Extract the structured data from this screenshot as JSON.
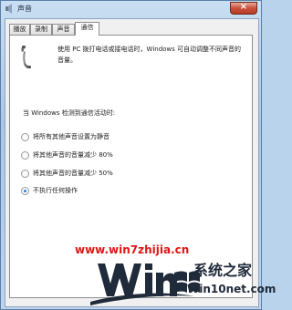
{
  "window": {
    "title": "声音",
    "close_glyph": "×"
  },
  "tabs": [
    {
      "label": "播放",
      "active": false
    },
    {
      "label": "录制",
      "active": false
    },
    {
      "label": "声音",
      "active": false
    },
    {
      "label": "通信",
      "active": true
    }
  ],
  "panel": {
    "description": "使用 PC 拨打电话或接电话时，Windows 可自动调整不同声音的音量。",
    "question": "当 Windows 检测到通信活动时:",
    "options": [
      {
        "label": "将所有其他声音设置为静音",
        "checked": false
      },
      {
        "label": "将其他声音的音量减少 80%",
        "checked": false
      },
      {
        "label": "将其他声音的音量减少 50%",
        "checked": false
      },
      {
        "label": "不执行任何操作",
        "checked": true
      }
    ]
  },
  "watermark": {
    "url": "www.win7zhijia.cn",
    "brand": "系统之家",
    "site": "Win10net.com",
    "colors": {
      "url": "#e01515",
      "logo": "#1f2a3a"
    }
  }
}
